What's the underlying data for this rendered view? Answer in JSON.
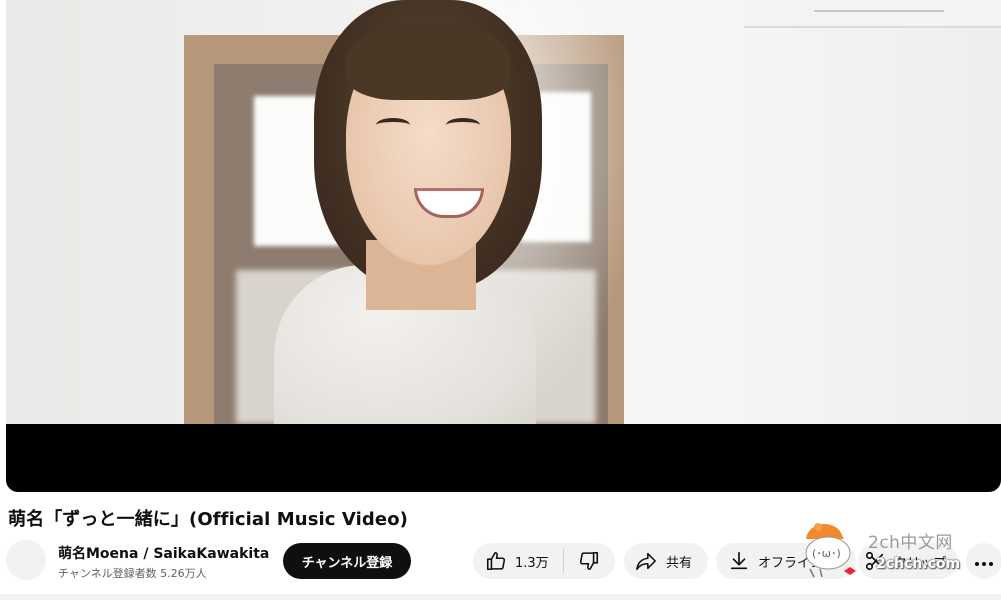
{
  "video": {
    "title": "萌名「ずっと一緒に」(Official Music Video)"
  },
  "channel": {
    "name": "萌名Moena / SaikaKawakita",
    "subscribers": "チャンネル登録者数 5.26万人",
    "subscribe_label": "チャンネル登録"
  },
  "actions": {
    "like_count": "1.3万",
    "share_label": "共有",
    "offline_label": "オフライン",
    "clip_label": "クリップ"
  },
  "icons": {
    "like": "thumbs-up-icon",
    "dislike": "thumbs-down-icon",
    "share": "share-arrow-icon",
    "download": "download-icon",
    "clip": "scissors-icon",
    "more": "more-horizontal-icon"
  },
  "watermark": {
    "line1": "2ch中文网",
    "line2": "2chcn.com"
  }
}
